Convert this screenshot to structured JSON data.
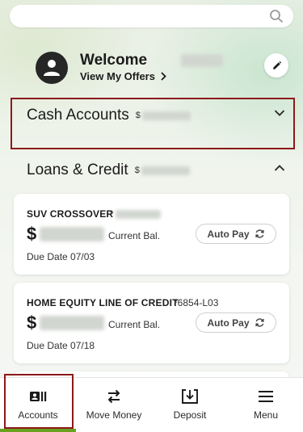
{
  "search": {
    "placeholder": ""
  },
  "welcome": {
    "greeting": "Welcome",
    "offers_link": "View My Offers"
  },
  "sections": {
    "cash": {
      "title": "Cash Accounts",
      "amount_prefix": "$"
    },
    "loans": {
      "title": "Loans & Credit",
      "amount_prefix": "$"
    }
  },
  "accounts": [
    {
      "name": "SUV CROSSOVER",
      "acct": "*",
      "balance_prefix": "$",
      "balance_label": "Current Bal.",
      "due": "Due Date 07/03",
      "autopay": "Auto Pay"
    },
    {
      "name": "HOME EQUITY LINE OF CREDIT",
      "acct": "*6854-L03",
      "balance_prefix": "$",
      "balance_label": "Current Bal.",
      "due": "Due Date 07/18",
      "autopay": "Auto Pay"
    }
  ],
  "bottom_nav": [
    {
      "label": "Accounts",
      "icon": "accounts-icon",
      "active": true
    },
    {
      "label": "Move Money",
      "icon": "transfer-icon"
    },
    {
      "label": "Deposit",
      "icon": "deposit-icon"
    },
    {
      "label": "Menu",
      "icon": "menu-icon"
    }
  ],
  "colors": {
    "highlight": "#8b1a1a",
    "active_accent": "#6aa121",
    "avatar": "#262626"
  }
}
